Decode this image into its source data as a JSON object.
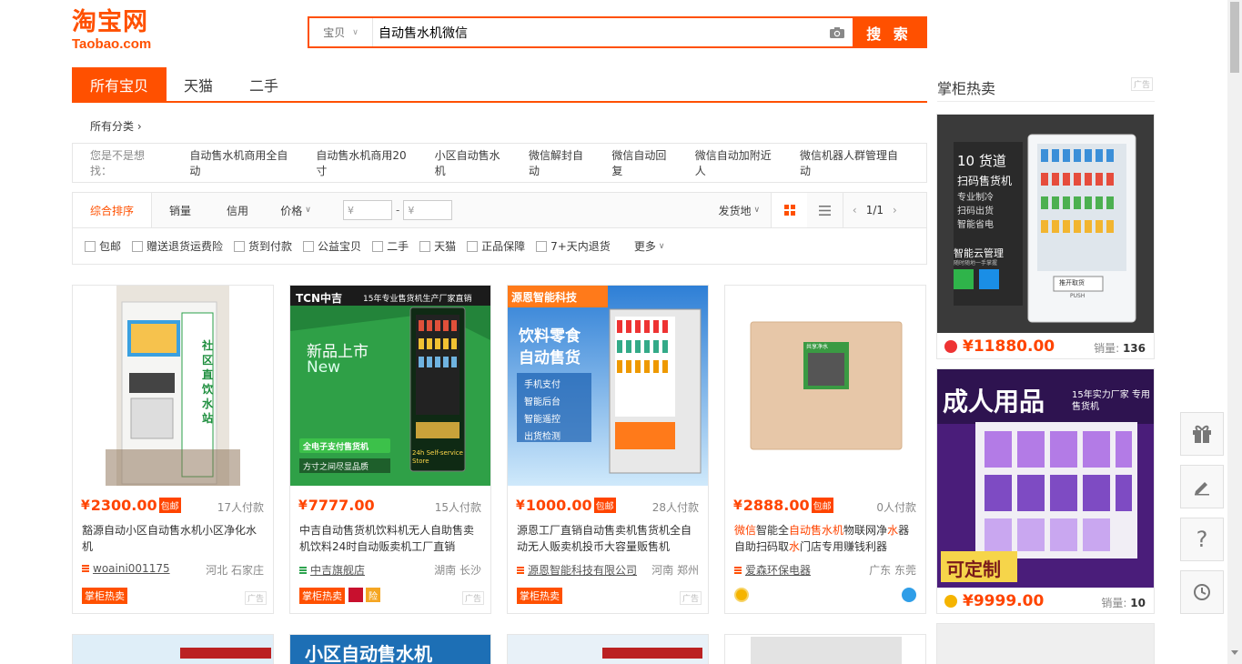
{
  "logo": {
    "cn": "淘宝网",
    "en": "Taobao.com"
  },
  "search": {
    "scope": "宝贝",
    "query": "自动售水机微信",
    "button": "搜 索"
  },
  "tabs": [
    {
      "label": "所有宝贝"
    },
    {
      "label": "天猫"
    },
    {
      "label": "二手"
    }
  ],
  "category": {
    "label": "所有分类 ›"
  },
  "suggest": {
    "label": "您是不是想找：",
    "items": [
      "自动售水机商用全自动",
      "自动售水机商用20寸",
      "小区自动售水机",
      "微信解封自动",
      "微信自动回复",
      "微信自动加附近人",
      "微信机器人群管理自动"
    ]
  },
  "sort": {
    "items": [
      "综合排序",
      "销量",
      "信用",
      "价格"
    ],
    "price_from": "¥",
    "price_to": "¥",
    "ship": "发货地",
    "page": "1/1"
  },
  "filters": [
    "包邮",
    "赠送退货运费险",
    "货到付款",
    "公益宝贝",
    "二手",
    "天猫",
    "正品保障",
    "7+天内退货",
    "更多"
  ],
  "products": [
    {
      "price": "2300.00",
      "baoyou": "包邮",
      "paid": "17人付款",
      "title": "豁源自动小区自动售水机小区净化水机",
      "shop": "woaini001175",
      "loc": "河北 石家庄",
      "tag": "掌柜热卖",
      "ad": "广告",
      "img_text": "社区直饮水站"
    },
    {
      "price": "7777.00",
      "baoyou": "",
      "paid": "15人付款",
      "title": "中吉自动售货机饮料机无人自助售卖机饮料24时自动贩卖机工厂直销",
      "shop": "中吉旗舰店",
      "loc": "湖南 长沙",
      "tag": "掌柜热卖",
      "ad": "广告",
      "img_text": "新品上市",
      "img_sub": "New",
      "img_brand": "TCN中吉",
      "img_slogan": "15年专业售货机生产厂家直销",
      "img_badge": "全电子支付售货机",
      "img_foot": "方寸之间尽显品质",
      "img_store": "24h Self-service Store",
      "badge_bao": "险"
    },
    {
      "price": "1000.00",
      "baoyou": "包邮",
      "paid": "28人付款",
      "title": "源恩工厂直销自动售卖机售货机全自动无人贩卖机投币大容量贩售机",
      "shop": "源恩智能科技有限公司",
      "loc": "河南 郑州",
      "tag": "掌柜热卖",
      "ad": "广告",
      "img_text": "源恩智能科技",
      "img_big": "饮料零食 自动售货",
      "img_feats": [
        "手机支付",
        "智能后台",
        "智能遥控",
        "出货检测"
      ]
    },
    {
      "price": "2888.00",
      "baoyou": "包邮",
      "paid": "0人付款",
      "title_parts": [
        {
          "t": "微信",
          "hl": true
        },
        {
          "t": "智能全",
          "hl": false
        },
        {
          "t": "自动售水机",
          "hl": true
        },
        {
          "t": "物联网净",
          "hl": false
        },
        {
          "t": "水",
          "hl": true
        },
        {
          "t": "器自助扫码取",
          "hl": false
        },
        {
          "t": "水",
          "hl": true
        },
        {
          "t": "门店专用赚钱利器",
          "hl": false
        }
      ],
      "shop": "爱森环保电器",
      "loc": "广东 东莞",
      "img_text": "共享净水"
    }
  ],
  "sidebar": {
    "title": "掌柜热卖",
    "ad": "广告",
    "items": [
      {
        "price": "11880.00",
        "sales_label": "销量:",
        "sales": "136",
        "img_head": "10 货道",
        "img_sub": "扫码售货机",
        "img_lines": [
          "专业制冷",
          "扫码出货",
          "智能省电"
        ],
        "img_cloud": "智能云管理",
        "img_cloud_sub": "随时随地一手掌握",
        "img_push": "推开取货",
        "img_push_en": "PUSH"
      },
      {
        "price": "9999.00",
        "sales_label": "销量:",
        "sales": "10",
        "img_head": "成人用品",
        "img_sub": "15年实力厂家 专用售货机",
        "img_foot": "可定制"
      }
    ]
  },
  "float_buttons": [
    "gift-icon",
    "edit-icon",
    "help-icon",
    "history-icon"
  ],
  "row2": {
    "p2_text": "小区自动售水机"
  },
  "colors": {
    "brand": "#ff5000",
    "price": "#ff4400"
  }
}
